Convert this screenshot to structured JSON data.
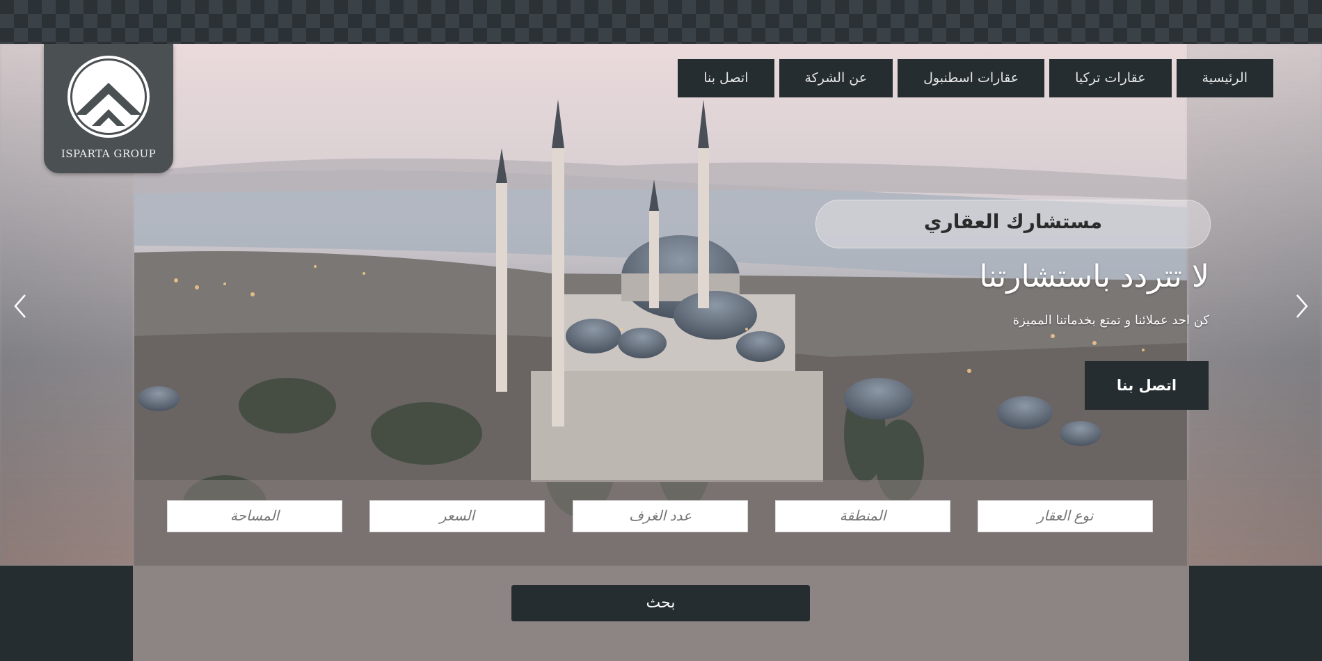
{
  "brand": {
    "logo_text": "ISPARTA GROUP"
  },
  "nav": {
    "items": [
      {
        "label": "الرئيسية"
      },
      {
        "label": "عقارات تركيا"
      },
      {
        "label": "عقارات اسطنبول"
      },
      {
        "label": "عن الشركة"
      },
      {
        "label": "اتصل بنا"
      }
    ]
  },
  "hero": {
    "pill_text": "مستشارك العقاري",
    "headline": "لا تتردد باستشارتنا",
    "subline": "كن احد عملائنا و تمتع بخدماتنا المميزة",
    "cta_label": "اتصل بنا",
    "prev_icon": "chevron-left-icon",
    "next_icon": "chevron-right-icon"
  },
  "search": {
    "fields": [
      {
        "placeholder": "نوع العقار"
      },
      {
        "placeholder": "المنطقة"
      },
      {
        "placeholder": "عدد الغرف"
      },
      {
        "placeholder": "السعر"
      },
      {
        "placeholder": "المساحة"
      }
    ],
    "button_label": "بحث"
  },
  "colors": {
    "dark": "#262d31",
    "logo_bg": "#4b5053",
    "panel": "#8d8583"
  }
}
